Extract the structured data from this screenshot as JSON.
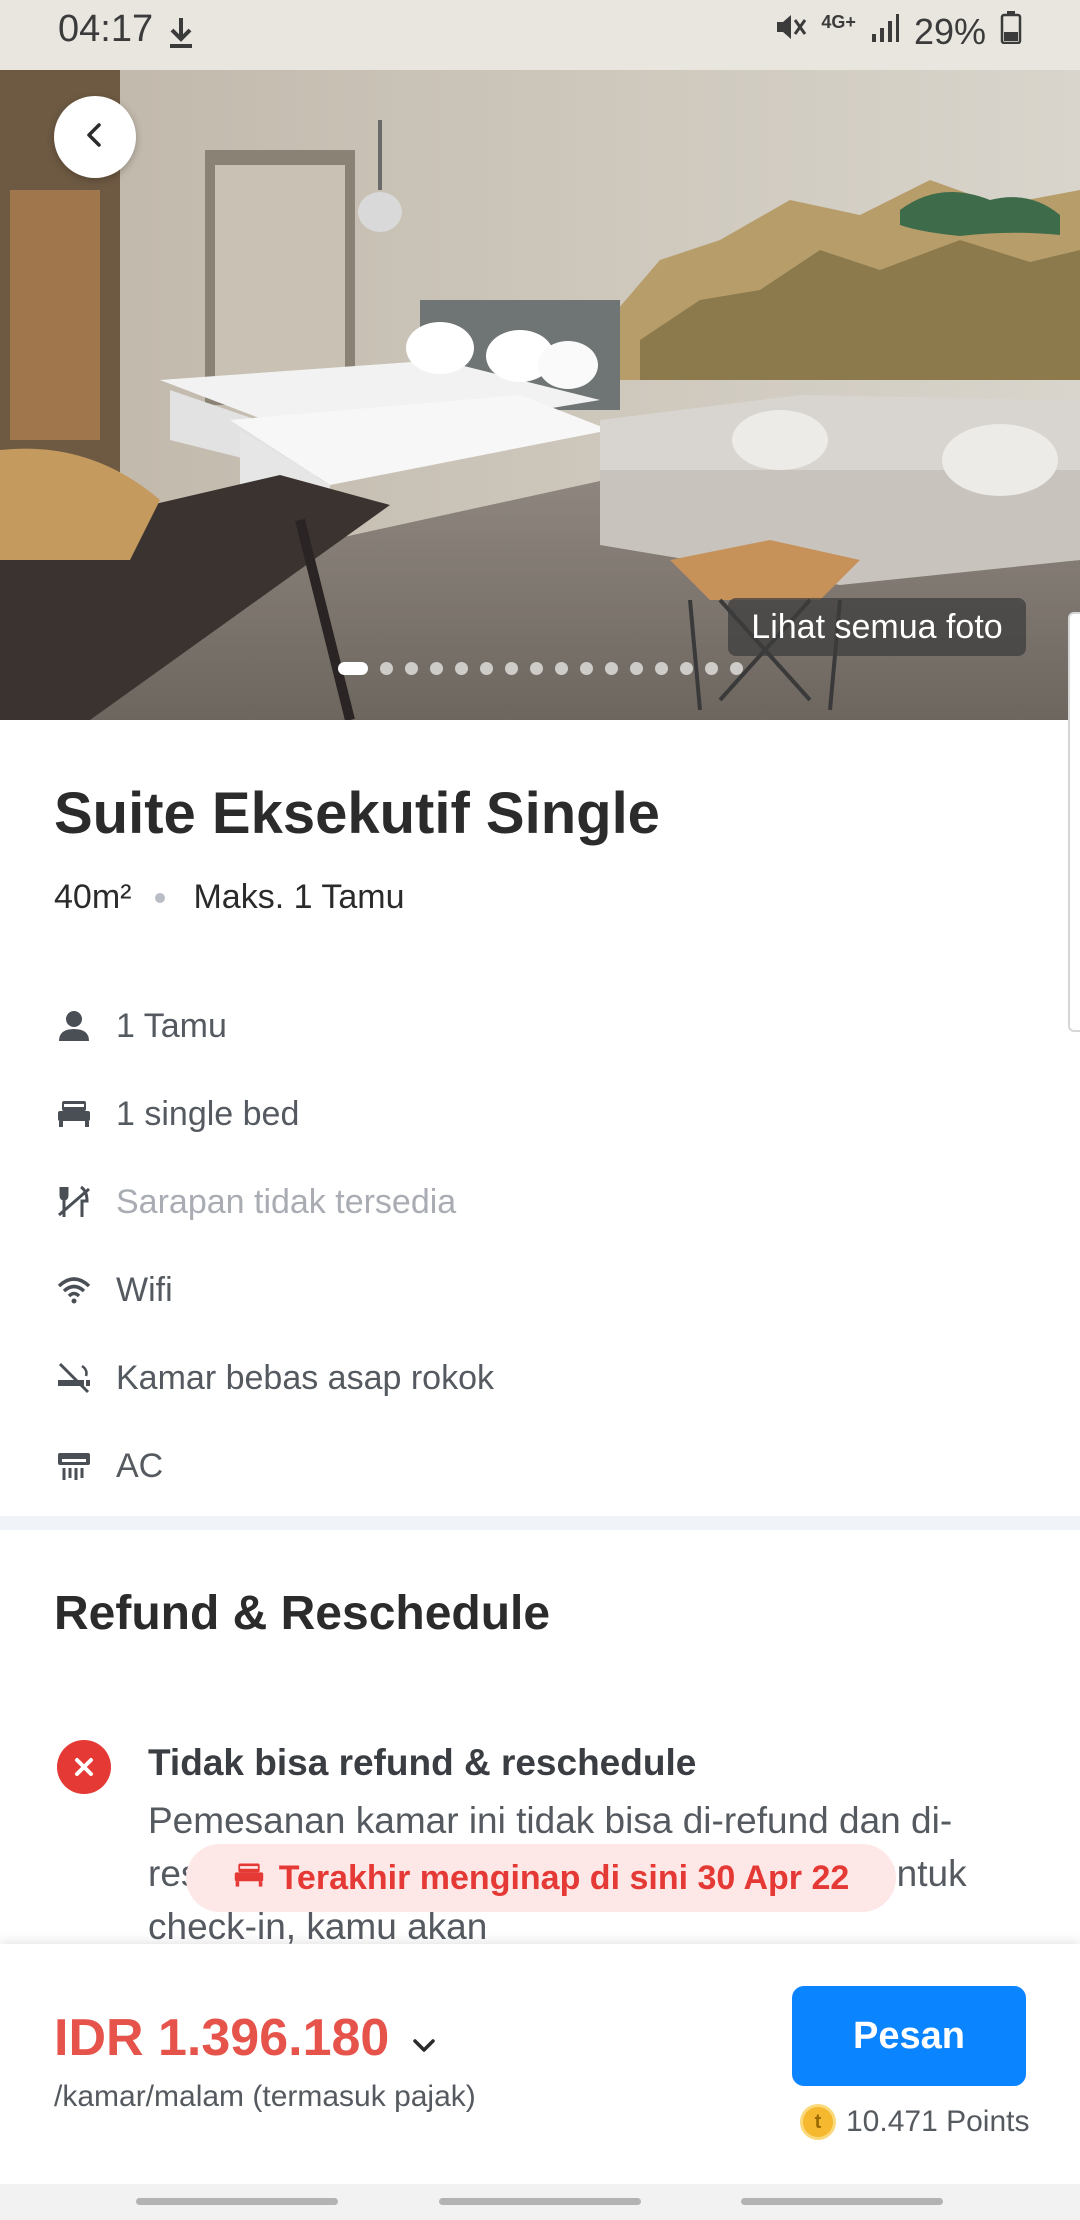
{
  "status_bar": {
    "time": "04:17",
    "network": "4G+",
    "battery": "29%"
  },
  "gallery": {
    "see_all_label": "Lihat semua foto",
    "photo_count": 16,
    "active_index": 0
  },
  "room": {
    "name": "Suite Eksekutif Single",
    "size": "40m²",
    "max_guests": "Maks. 1 Tamu",
    "facilities": [
      {
        "icon": "person-icon",
        "label": "1 Tamu",
        "available": true
      },
      {
        "icon": "bed-icon",
        "label": "1 single bed",
        "available": true
      },
      {
        "icon": "no-breakfast-icon",
        "label": "Sarapan tidak tersedia",
        "available": false
      },
      {
        "icon": "wifi-icon",
        "label": "Wifi",
        "available": true
      },
      {
        "icon": "no-smoking-icon",
        "label": "Kamar bebas asap rokok",
        "available": true
      },
      {
        "icon": "ac-icon",
        "label": "AC",
        "available": true
      }
    ]
  },
  "refund": {
    "section_title": "Refund & Reschedule",
    "policy_title": "Tidak bisa refund & reschedule",
    "policy_text": "Pemesanan kamar ini tidak bisa di-refund dan di-reschedule. Jika tidak datang ke akomodasi untuk check-in, kamu akan"
  },
  "toast": {
    "text": "Terakhir menginap di sini 30 Apr 22"
  },
  "booking": {
    "price": "IDR 1.396.180",
    "price_note": "/kamar/malam (termasuk pajak)",
    "button_label": "Pesan",
    "points": "10.471 Points"
  },
  "colors": {
    "accent_blue": "#0a84ff",
    "price_red": "#e5534b",
    "error_red": "#e53935",
    "toast_bg": "#fde7e7"
  }
}
